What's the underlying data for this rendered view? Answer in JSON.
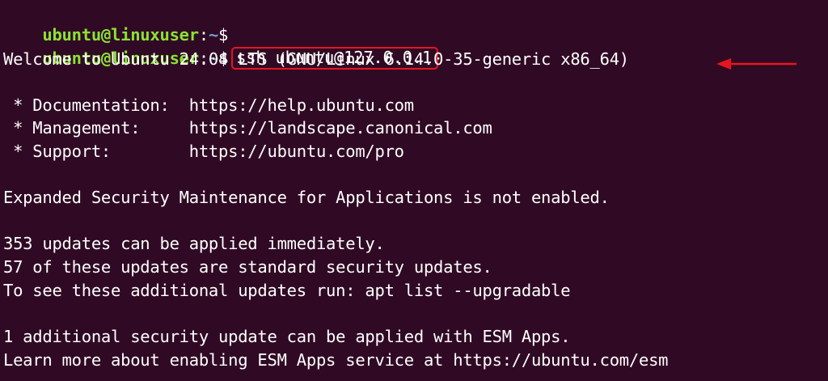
{
  "prompt": {
    "user_host": "ubuntu@linuxuser",
    "colon": ":",
    "path": "~",
    "dollar": "$"
  },
  "command": "ssh ubuntu@127.0.0.1",
  "output": {
    "welcome": "Welcome to Ubuntu 24.04 LTS (GNU/Linux 6.14.0-35-generic x86_64)",
    "documentation": " * Documentation:  https://help.ubuntu.com",
    "management": " * Management:     https://landscape.canonical.com",
    "support": " * Support:        https://ubuntu.com/pro",
    "esm_status": "Expanded Security Maintenance for Applications is not enabled.",
    "updates_count": "353 updates can be applied immediately.",
    "security_updates": "57 of these updates are standard security updates.",
    "see_updates": "To see these additional updates run: apt list --upgradable",
    "esm_update": "1 additional security update can be applied with ESM Apps.",
    "esm_learn": "Learn more about enabling ESM Apps service at https://ubuntu.com/esm"
  },
  "colors": {
    "background": "#300a24",
    "user_host": "#8ae234",
    "path": "#729fcf",
    "annotation": "#e8141e"
  },
  "icons": {
    "annotation_arrow": "left-arrow-icon"
  }
}
